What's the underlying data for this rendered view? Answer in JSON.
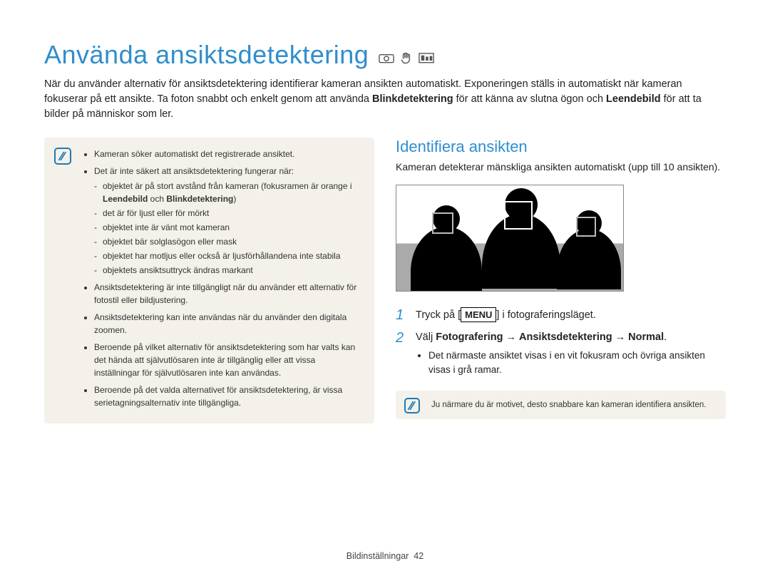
{
  "title": "Använda ansiktsdetektering",
  "intro": {
    "part1": "När du använder alternativ för ansiktsdetektering identifierar kameran ansikten automatiskt. Exponeringen ställs in automatiskt när kameran fokuserar på ett ansikte. Ta foton snabbt och enkelt genom att använda ",
    "bold1": "Blinkdetektering",
    "part2": " för att känna av slutna ögon och ",
    "bold2": "Leendebild",
    "part3": " för att ta bilder på människor som ler."
  },
  "notes": {
    "b1": "Kameran söker automatiskt det registrerade ansiktet.",
    "b2_intro": "Det är inte säkert att ansiktsdetektering fungerar när:",
    "b2_sub1a": "objektet är på stort avstånd från kameran (fokusramen är orange i ",
    "b2_sub1b_bold": "Leendebild",
    "b2_sub1c": " och ",
    "b2_sub1d_bold": "Blinkdetektering",
    "b2_sub1e": ")",
    "b2_sub2": "det är för ljust eller för mörkt",
    "b2_sub3": "objektet inte är vänt mot kameran",
    "b2_sub4": "objektet bär solglasögon eller mask",
    "b2_sub5": "objektet har motljus eller också är ljusförhållandena inte stabila",
    "b2_sub6": "objektets ansiktsuttryck ändras markant",
    "b3": "Ansiktsdetektering är inte tillgängligt när du använder ett alternativ för fotostil eller bildjustering.",
    "b4": "Ansiktsdetektering kan inte användas när du använder den digitala zoomen.",
    "b5": "Beroende på vilket alternativ för ansiktsdetektering som har valts kan det hända att självutlösaren inte är tillgänglig eller att vissa inställningar för självutlösaren inte kan användas.",
    "b6": "Beroende på det valda alternativet för ansiktsdetektering, är vissa serietagningsalternativ inte tillgängliga."
  },
  "section_heading": "Identifiera ansikten",
  "section_desc": "Kameran detekterar mänskliga ansikten automatiskt (upp till 10 ansikten).",
  "steps": {
    "s1_num": "1",
    "s1_a": "Tryck på [",
    "s1_menu": "MENU",
    "s1_b": "] i fotograferingsläget.",
    "s2_num": "2",
    "s2_a": "Välj ",
    "s2_b_bold": "Fotografering",
    "s2_c": " → ",
    "s2_d_bold": "Ansiktsdetektering",
    "s2_e": " → ",
    "s2_f_bold": "Normal",
    "s2_g": ".",
    "s2_bullet": "Det närmaste ansiktet visas i en vit fokusram och övriga ansikten visas i grå ramar."
  },
  "tip": "Ju närmare du är motivet, desto snabbare kan kameran identifiera ansikten.",
  "footer_label": "Bildinställningar",
  "footer_page": "42"
}
